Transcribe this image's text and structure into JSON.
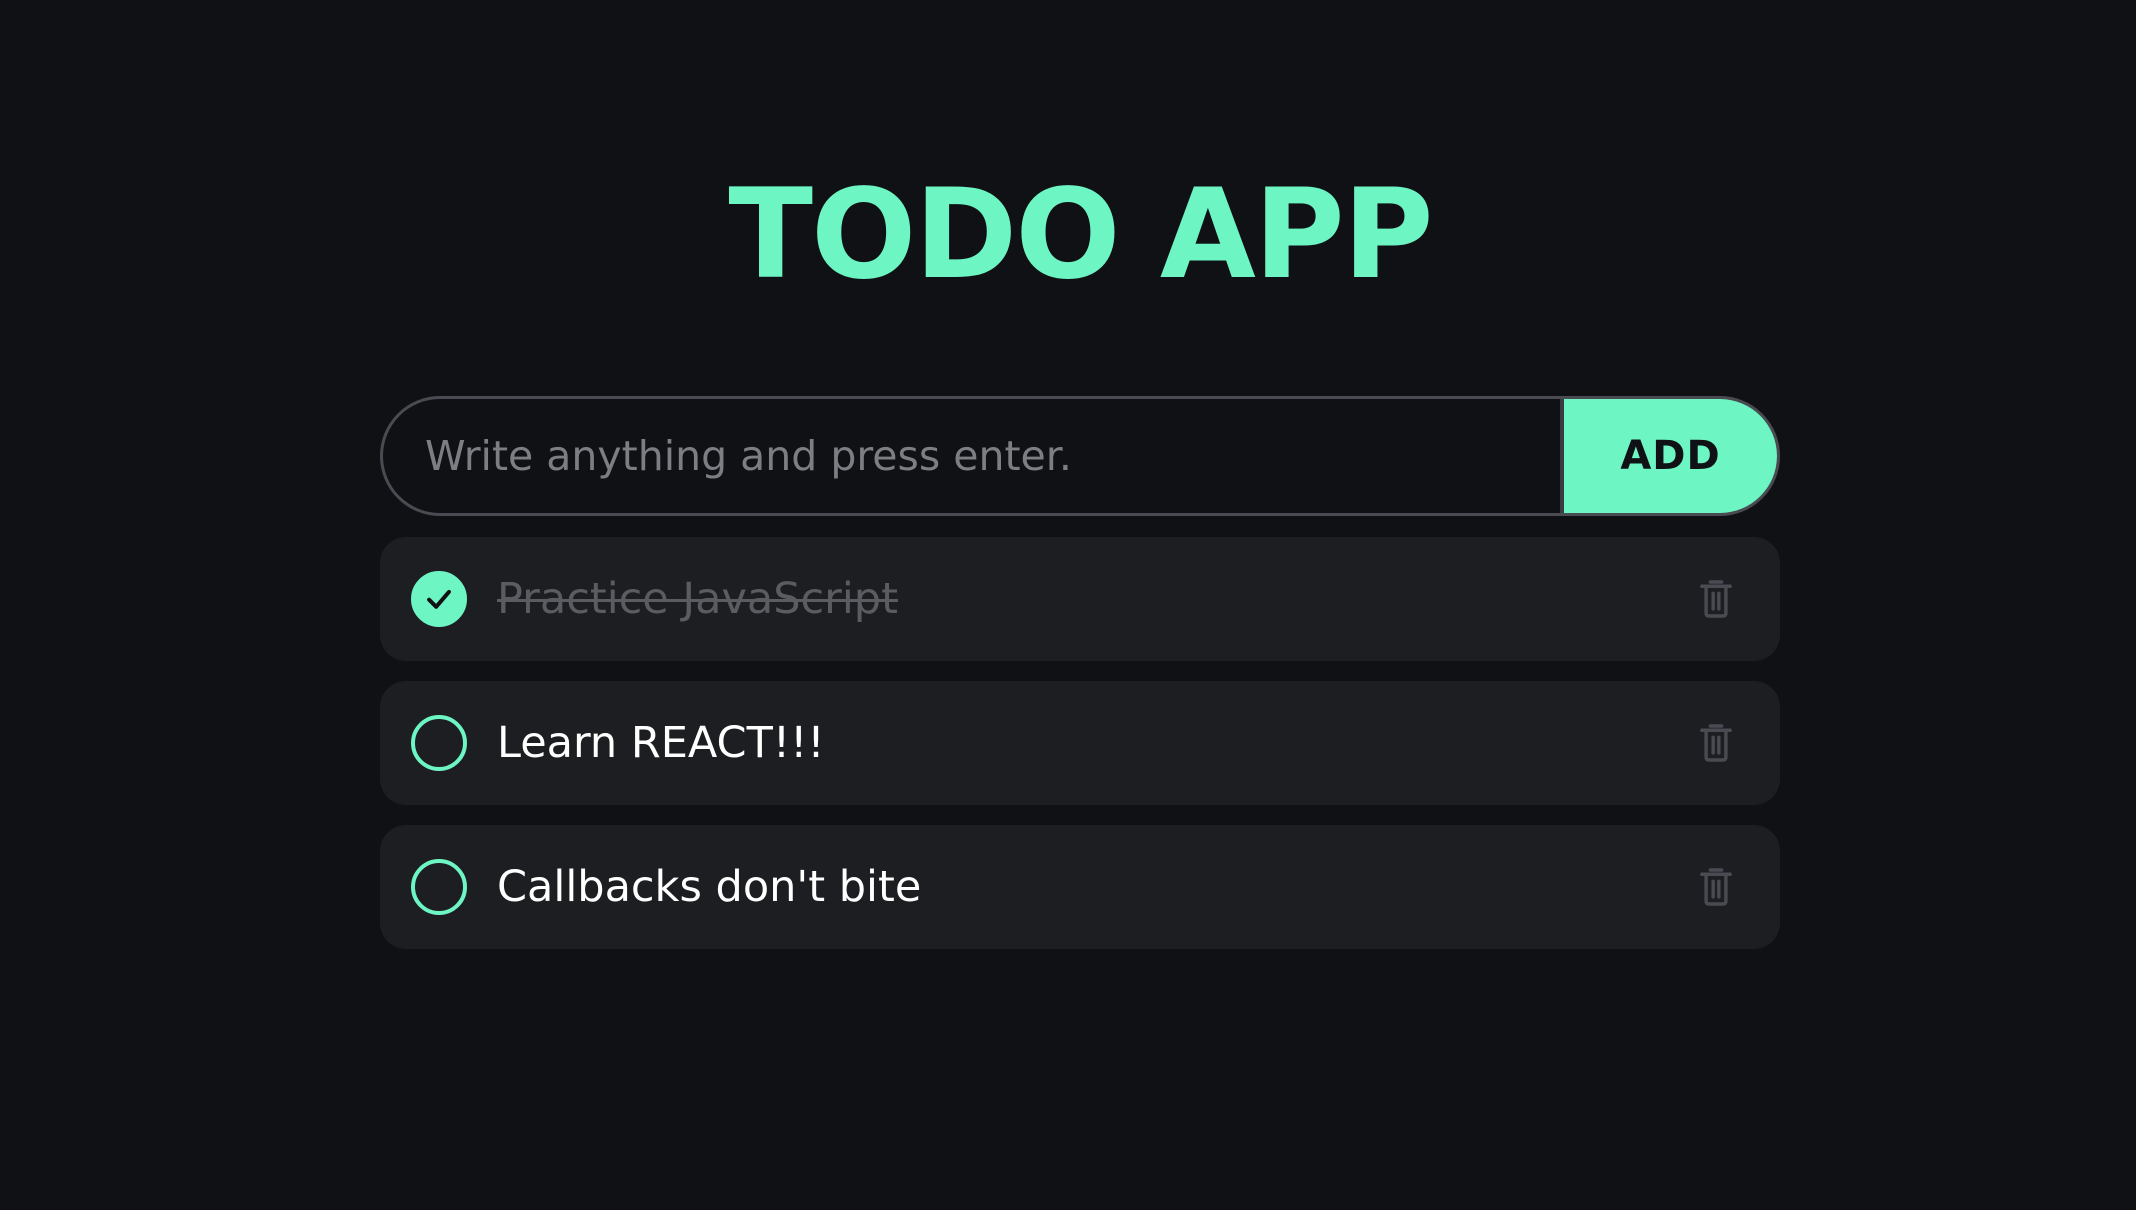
{
  "app": {
    "title": "TODO APP"
  },
  "add_form": {
    "input_placeholder": "Write anything and press enter.",
    "input_value": "",
    "add_label": "ADD"
  },
  "todos": [
    {
      "text": "Practice JavaScript",
      "completed": true
    },
    {
      "text": "Learn REACT!!!",
      "completed": false
    },
    {
      "text": "Callbacks don't bite",
      "completed": false
    }
  ],
  "colors": {
    "background": "#101115",
    "accent": "#6df5c4",
    "card": "#1d1e22",
    "muted": "#5b5c62"
  },
  "icons": {
    "check": "checkmark-icon",
    "delete": "trash-icon"
  }
}
